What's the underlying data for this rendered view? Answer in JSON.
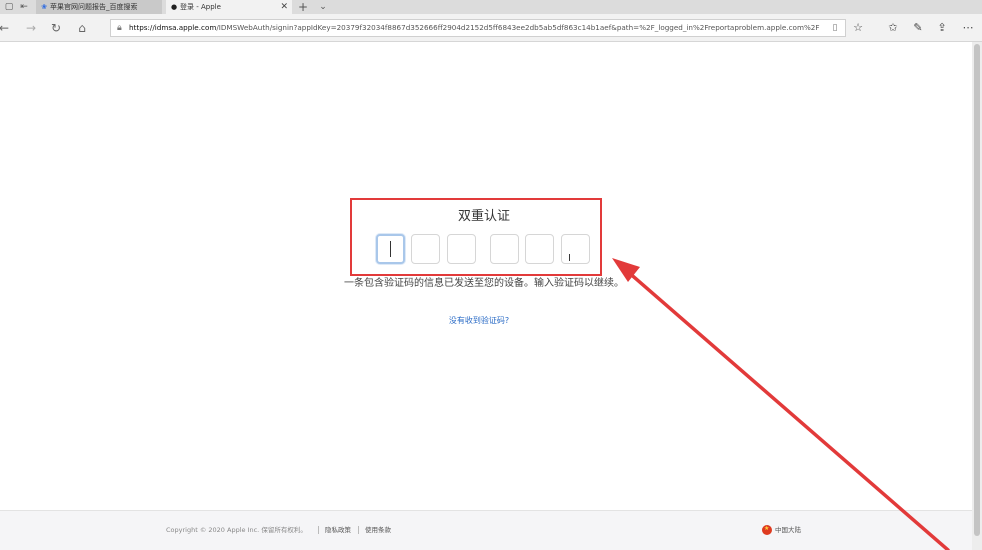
{
  "browser": {
    "tabs": [
      {
        "label": "苹果官网问题报告_百度搜索",
        "icon": "baidu-paw-icon",
        "active": false
      },
      {
        "label": "登录 - Apple",
        "icon": "apple-logo-icon",
        "active": true
      }
    ],
    "tab_close": "✕",
    "new_tab": "+",
    "tab_menu": "⌄",
    "url_host": "https://idmsa.apple.com",
    "url_rest": "/IDMSWebAuth/signin?appIdKey=20379f32034f8867d352666ff2904d2152d5ff6843ee2db5ab5df863c14b1aef&path=%2F_logged_in%2Freportaproblem.apple.com%2F",
    "nav_icons": [
      "back-arrow-icon",
      "forward-arrow-icon",
      "refresh-icon",
      "home-icon"
    ],
    "toolbar_icons": [
      "favorite-star-icon",
      "favorites-bar-icon",
      "pen-icon",
      "share-icon",
      "more-icon"
    ]
  },
  "auth": {
    "title": "双重认证",
    "digit_count": 6,
    "description": "一条包含验证码的信息已发送至您的设备。输入验证码以继续。",
    "resend_link": "没有收到验证码?"
  },
  "footer": {
    "copyright": "Copyright © 2020 Apple Inc. 保留所有权利。",
    "privacy": "隐私政策",
    "terms": "使用条款",
    "region": "中国大陆"
  },
  "annotation": {
    "highlight_color": "#e23a3a",
    "arrow_color": "#e23a3a"
  }
}
